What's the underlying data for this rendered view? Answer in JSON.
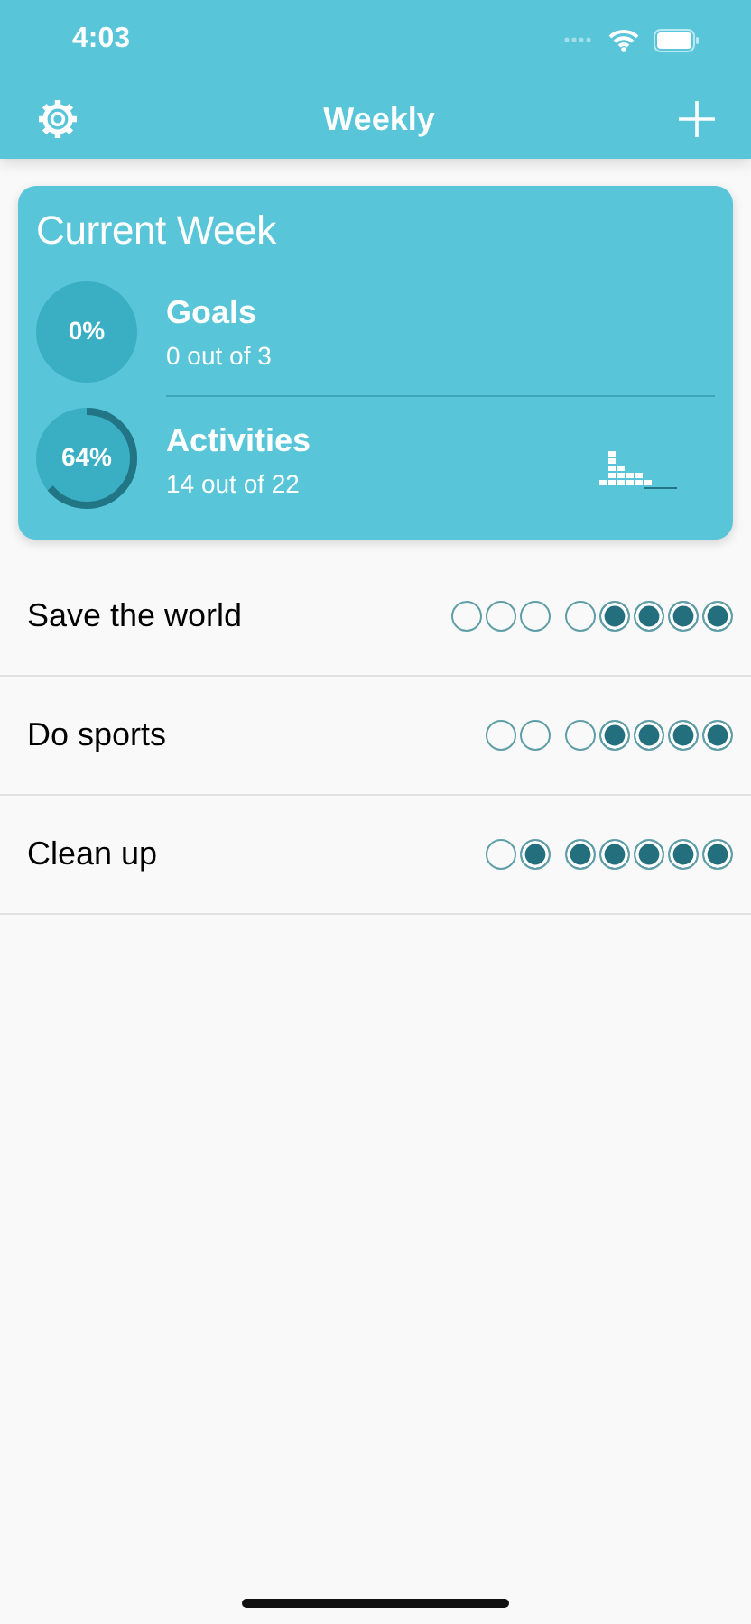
{
  "status_bar": {
    "time": "4:03"
  },
  "nav": {
    "title": "Weekly"
  },
  "summary": {
    "title": "Current Week",
    "stats": [
      {
        "label": "Goals",
        "percent": "0%",
        "detail": "0 out of 3"
      },
      {
        "label": "Activities",
        "percent": "64%",
        "detail": "14 out of 22"
      }
    ]
  },
  "goals": [
    {
      "name": "Save the world",
      "goal_dots": [
        {
          "checked": false
        },
        {
          "checked": false
        },
        {
          "checked": false
        }
      ],
      "activity_dots": [
        {
          "checked": false
        },
        {
          "checked": true
        },
        {
          "checked": true
        },
        {
          "checked": true
        },
        {
          "checked": true
        }
      ]
    },
    {
      "name": "Do sports",
      "goal_dots": [
        {
          "checked": false
        },
        {
          "checked": false
        }
      ],
      "activity_dots": [
        {
          "checked": false
        },
        {
          "checked": true
        },
        {
          "checked": true
        },
        {
          "checked": true
        },
        {
          "checked": true
        }
      ]
    },
    {
      "name": "Clean up",
      "goal_dots": [
        {
          "checked": false
        },
        {
          "checked": true
        }
      ],
      "activity_dots": [
        {
          "checked": true
        },
        {
          "checked": true
        },
        {
          "checked": true
        },
        {
          "checked": true
        },
        {
          "checked": true
        }
      ]
    }
  ]
}
